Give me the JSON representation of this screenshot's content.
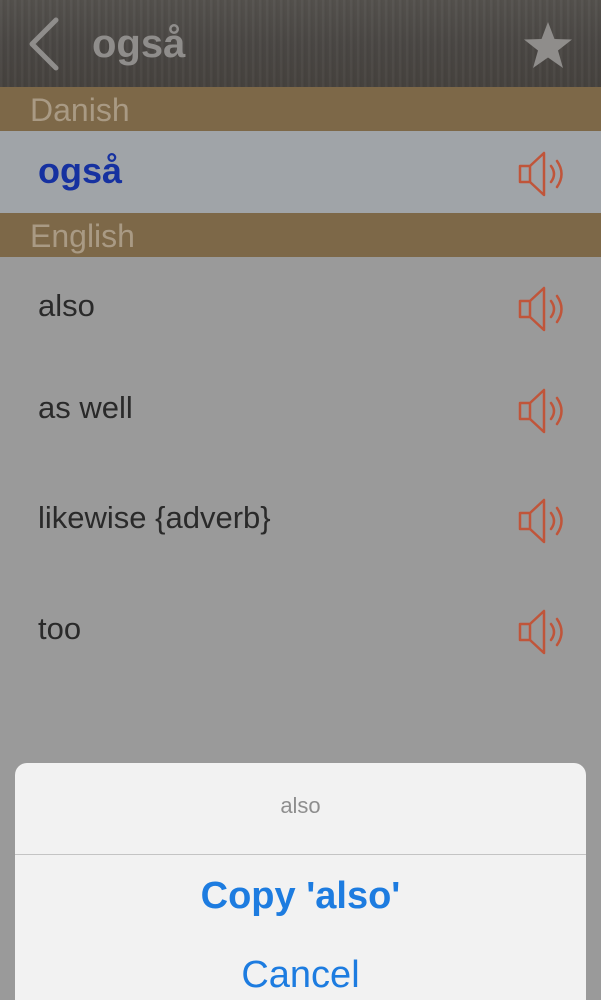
{
  "navbar": {
    "title": "også",
    "back_icon": "chevron-left-icon",
    "favorite_icon": "star-icon"
  },
  "sections": {
    "source_language": "Danish",
    "target_language": "English"
  },
  "source_entry": {
    "term": "også",
    "audio_icon": "speaker-icon"
  },
  "translations": [
    {
      "term": "also"
    },
    {
      "term": "as well"
    },
    {
      "term": "likewise {adverb}"
    },
    {
      "term": "too"
    }
  ],
  "action_sheet": {
    "title": "also",
    "copy_label": "Copy 'also'",
    "cancel_label": "Cancel"
  },
  "colors": {
    "section_header_bg": "#7d6848",
    "speaker_icon": "#c0553a",
    "source_term": "#1631a0",
    "action_blue": "#1d7ce0"
  }
}
